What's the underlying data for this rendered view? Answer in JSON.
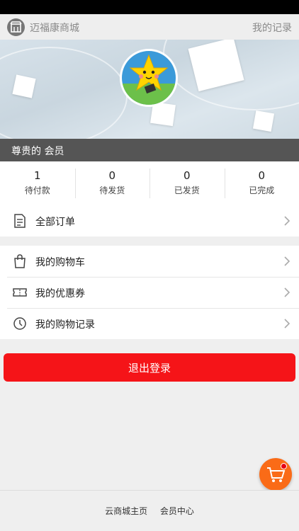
{
  "topbar": {
    "store_name": "迈福康商城",
    "records_link": "我的记录"
  },
  "member": {
    "level_text": "尊贵的 会员"
  },
  "stats": [
    {
      "count": "1",
      "label": "待付款"
    },
    {
      "count": "0",
      "label": "待发货"
    },
    {
      "count": "0",
      "label": "已发货"
    },
    {
      "count": "0",
      "label": "已完成"
    }
  ],
  "menu": {
    "all_orders": "全部订单",
    "cart": "我的购物车",
    "coupons": "我的优惠券",
    "purchase_history": "我的购物记录"
  },
  "logout_label": "退出登录",
  "footer": {
    "home": "云商城主页",
    "member_center": "会员中心"
  },
  "icons": {
    "store": "store-icon",
    "orders": "document-icon",
    "cart": "shopping-bag-icon",
    "coupon": "ticket-icon",
    "history": "clock-icon",
    "chevron": "chevron-right-icon",
    "fab": "shopping-cart-icon"
  },
  "colors": {
    "accent": "#f51418",
    "fab": "#fa6b17",
    "member_bar": "#555555"
  }
}
